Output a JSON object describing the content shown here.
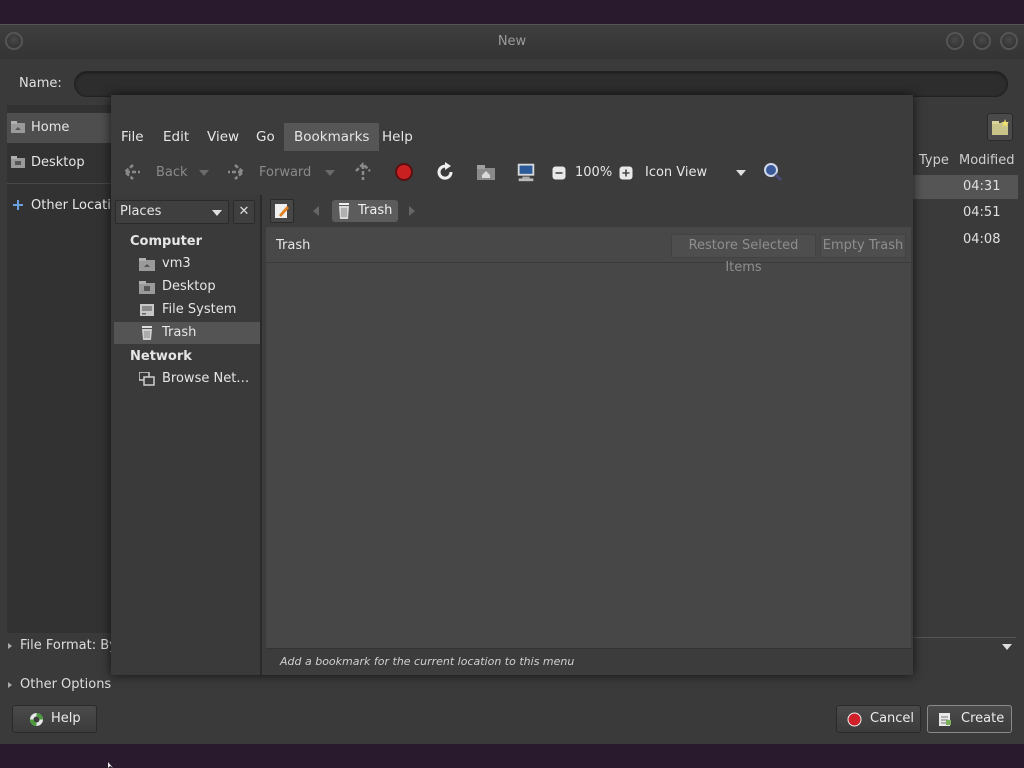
{
  "dialog": {
    "title": "New",
    "name_label": "Name:",
    "name_value": "",
    "places": [
      {
        "label": "Home",
        "icon": "home-folder-icon"
      },
      {
        "label": "Desktop",
        "icon": "desktop-folder-icon"
      },
      {
        "label": "Other Locatio",
        "icon": "plus-icon"
      }
    ],
    "columns": {
      "type": "Type",
      "modified": "Modified"
    },
    "times": [
      "04:31",
      "04:51",
      "04:08"
    ],
    "file_format_label": "File Format: By",
    "other_options_label": "Other Options",
    "help_label": "Help",
    "cancel_label": "Cancel",
    "create_label": "Create"
  },
  "file_manager": {
    "menu": [
      "File",
      "Edit",
      "View",
      "Go",
      "Bookmarks",
      "Help"
    ],
    "active_menu": "Bookmarks",
    "toolbar": {
      "back": "Back",
      "forward": "Forward",
      "zoom": "100%",
      "view_mode": "Icon View"
    },
    "sidebar": {
      "combo": "Places",
      "close": "✕",
      "computer_heading": "Computer",
      "computer_items": [
        "vm3",
        "Desktop",
        "File System",
        "Trash"
      ],
      "network_heading": "Network",
      "network_items": [
        "Browse Net…"
      ]
    },
    "location": {
      "crumb": "Trash"
    },
    "trash_bar": {
      "title": "Trash",
      "restore": "Restore Selected Items",
      "empty": "Empty Trash"
    },
    "status": "Add a bookmark for the current location to this menu"
  },
  "colors": {
    "accent_red": "#d0202a",
    "selection": "#545454"
  }
}
